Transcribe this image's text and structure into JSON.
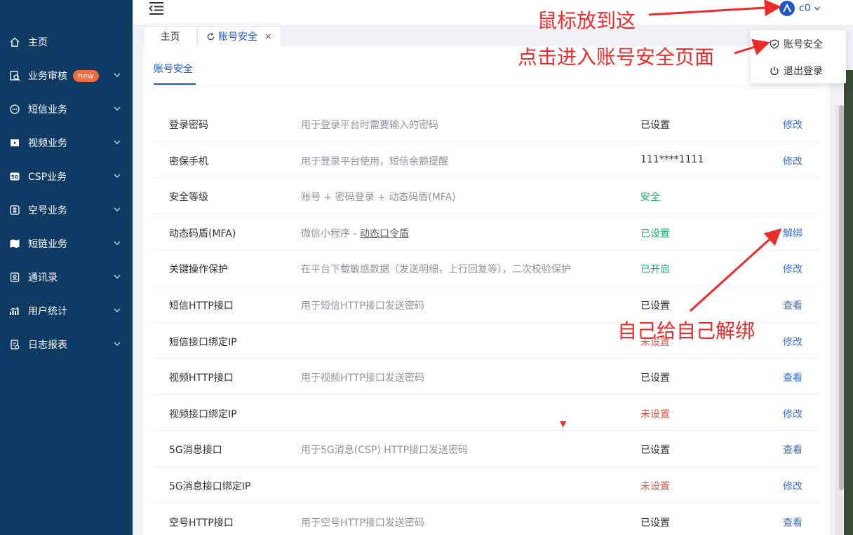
{
  "sidebar": {
    "items": [
      {
        "label": "主页",
        "icon": "home-icon",
        "chevron": false
      },
      {
        "label": "业务审核",
        "icon": "audit-icon",
        "badge": "new",
        "chevron": true
      },
      {
        "label": "短信业务",
        "icon": "message-icon",
        "chevron": true
      },
      {
        "label": "视频业务",
        "icon": "video-icon",
        "chevron": true
      },
      {
        "label": "CSP业务",
        "icon": "5g-icon",
        "chevron": true
      },
      {
        "label": "空号业务",
        "icon": "number-icon",
        "chevron": true
      },
      {
        "label": "短链业务",
        "icon": "map-icon",
        "chevron": true
      },
      {
        "label": "通讯录",
        "icon": "contacts-icon",
        "chevron": true
      },
      {
        "label": "用户统计",
        "icon": "stats-icon",
        "chevron": true
      },
      {
        "label": "日志报表",
        "icon": "report-icon",
        "chevron": true
      }
    ]
  },
  "header": {
    "username": "c0"
  },
  "tabs": [
    {
      "label": "主页"
    },
    {
      "label": "账号安全",
      "active": true,
      "close": "×"
    }
  ],
  "dropdown": {
    "items": [
      {
        "label": "账号安全",
        "icon": "shield-icon"
      },
      {
        "label": "退出登录",
        "icon": "power-icon"
      }
    ]
  },
  "page": {
    "title": "账号安全",
    "rows": [
      {
        "name": "登录密码",
        "desc": "用于登录平台时需要输入的密码",
        "status": "已设置",
        "status_type": "set",
        "action": "修改"
      },
      {
        "name": "密保手机",
        "desc": "用于登录平台使用，短信余额提醒",
        "status": "111****1111",
        "status_type": "set",
        "action": "修改"
      },
      {
        "name": "安全等级",
        "desc": "账号 + 密码登录 + 动态码盾(MFA)",
        "status": "安全",
        "status_type": "green",
        "action": ""
      },
      {
        "name": "动态码盾(MFA)",
        "desc": "微信小程序 - ",
        "desc_link": "动态口令盾",
        "status": "已设置",
        "status_type": "green",
        "action": "解绑"
      },
      {
        "name": "关键操作保护",
        "desc": "在平台下载敏感数据（发送明细，上行回复等），二次校验保护",
        "status": "已开启",
        "status_type": "green",
        "action": "修改"
      },
      {
        "name": "短信HTTP接口",
        "desc": "用于短信HTTP接口发送密码",
        "status": "已设置",
        "status_type": "set",
        "action": "查看"
      },
      {
        "name": "短信接口绑定IP",
        "desc": "",
        "status": "未设置",
        "status_type": "red",
        "action": "修改"
      },
      {
        "name": "视频HTTP接口",
        "desc": "用于视频HTTP接口发送密码",
        "status": "已设置",
        "status_type": "set",
        "action": "查看"
      },
      {
        "name": "视频接口绑定IP",
        "desc": "",
        "status": "未设置",
        "status_type": "red",
        "action": "修改"
      },
      {
        "name": "5G消息接口",
        "desc": "用于5G消息(CSP) HTTP接口发送密码",
        "status": "已设置",
        "status_type": "set",
        "action": "查看"
      },
      {
        "name": "5G消息接口绑定IP",
        "desc": "",
        "status": "未设置",
        "status_type": "red",
        "action": "修改"
      },
      {
        "name": "空号HTTP接口",
        "desc": "用于空号HTTP接口发送密码",
        "status": "已设置",
        "status_type": "set",
        "action": "查看"
      }
    ]
  },
  "annotations": {
    "hover_hint": "鼠标放到这",
    "click_hint": "点击进入账号安全页面",
    "unbind_hint": "自己给自己解绑"
  },
  "colors": {
    "sidebar_bg": "#0e3a64",
    "primary": "#1f56c8",
    "link": "#3d6fd6",
    "success": "#1fad6f",
    "danger": "#e05a4e",
    "annotation": "#ee2b2b"
  }
}
